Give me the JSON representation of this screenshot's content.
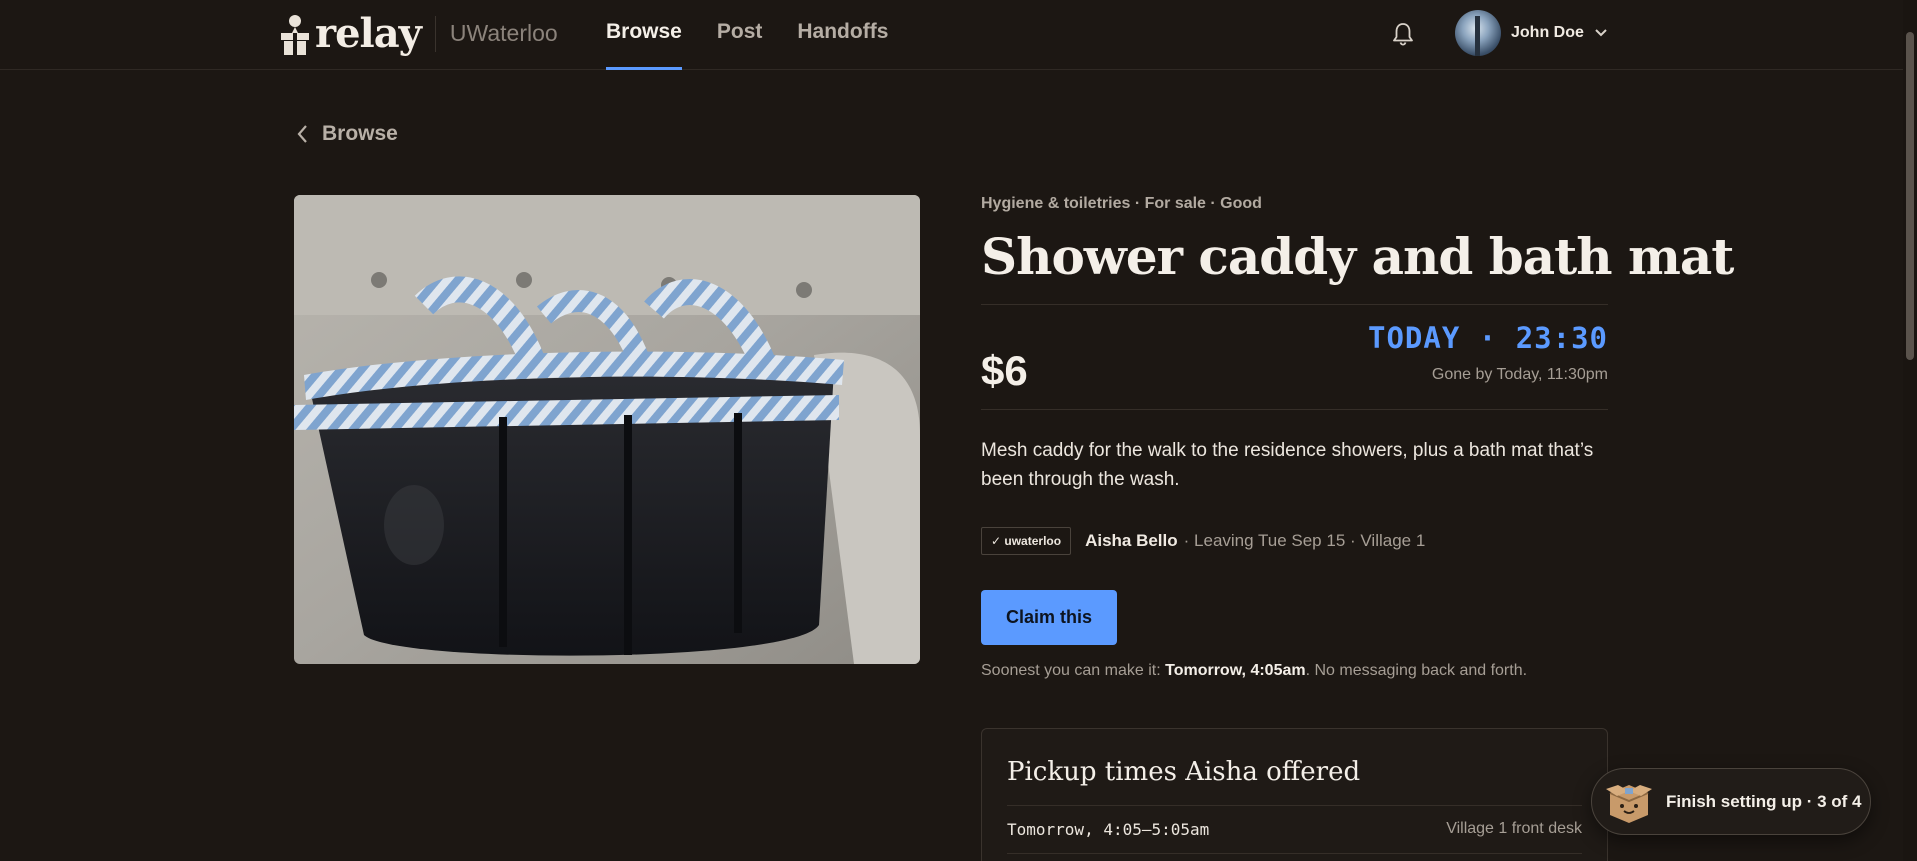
{
  "header": {
    "brand": "relay",
    "campus": "UWaterloo",
    "nav": [
      {
        "label": "Browse",
        "active": true
      },
      {
        "label": "Post",
        "active": false
      },
      {
        "label": "Handoffs",
        "active": false
      }
    ],
    "user_name": "John Doe",
    "icons": [
      "gift-icon",
      "bell-icon",
      "chevron-down-icon"
    ]
  },
  "breadcrumb": {
    "back_label": "Browse",
    "icon": "chevron-left-icon"
  },
  "listing": {
    "meta": "Hygiene & toiletries · For sale · Good",
    "title": "Shower caddy and bath mat",
    "price": "$6",
    "deadline": "TODAY · 23:30",
    "gone_by": "Gone by Today, 11:30pm",
    "description": "Mesh caddy for the walk to the residence showers, plus a bath mat that’s been through the wash.",
    "badge": "✓ uwaterloo",
    "seller_name": "Aisha Bello",
    "seller_meta": "· Leaving Tue Sep 15 · Village 1",
    "claim_label": "Claim this",
    "soonest_prefix": "Soonest you can make it: ",
    "soonest_time": "Tomorrow, 4:05am",
    "soonest_suffix": ". No messaging back and forth."
  },
  "pickup": {
    "heading": "Pickup times Aisha offered",
    "slots": [
      {
        "time": "Tomorrow, 4:05–5:05am",
        "location": "Village 1 front desk"
      }
    ]
  },
  "setup": {
    "label": "Finish setting up · 3 of 4"
  },
  "colors": {
    "background": "#1c1713",
    "accent": "#5b9aff",
    "text": "#ece6de",
    "muted": "#a69e95"
  }
}
